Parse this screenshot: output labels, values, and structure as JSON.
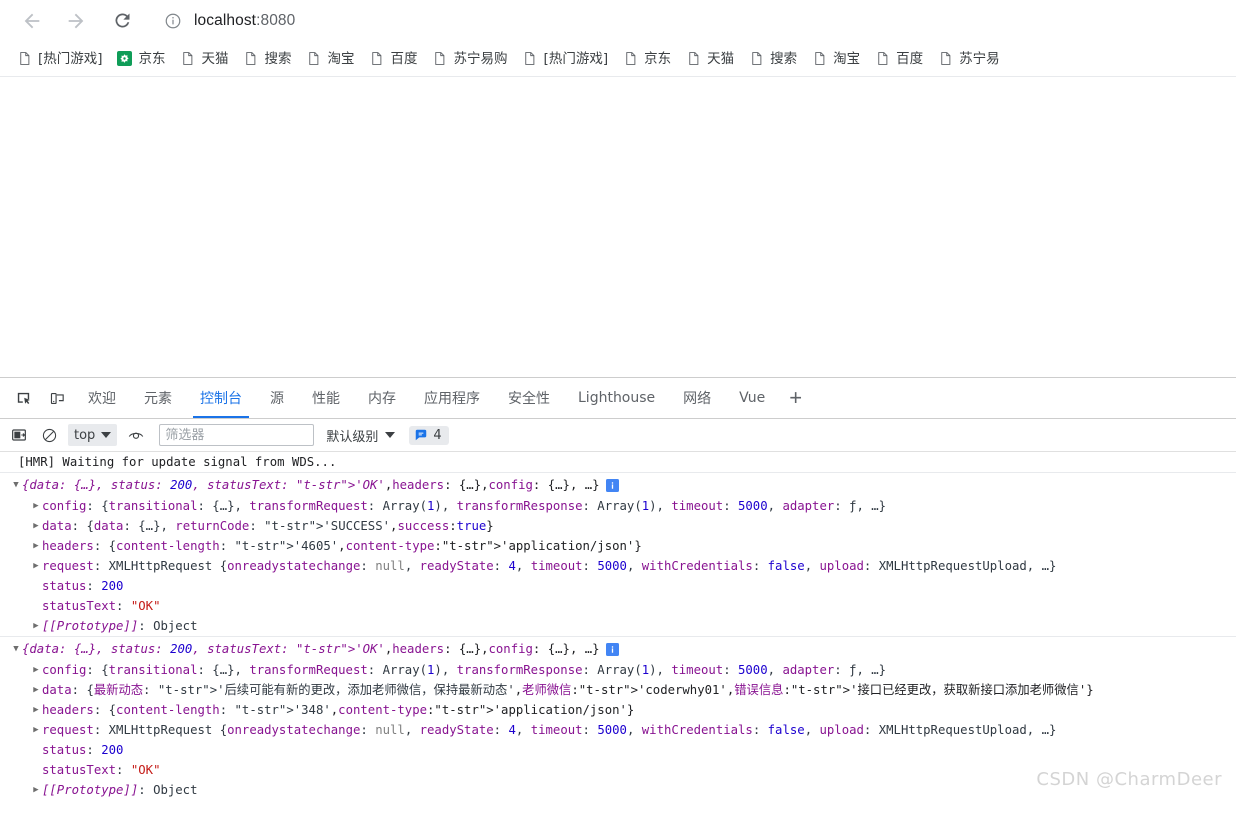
{
  "browser": {
    "nav": {
      "back_label": "Back",
      "forward_label": "Forward",
      "reload_label": "Reload"
    },
    "omnibox": {
      "url_host": "localhost",
      "url_rest": ":8080",
      "info_icon": "site-info-icon"
    },
    "bookmarks": [
      {
        "label": "[热门游戏]",
        "icon": "page-icon"
      },
      {
        "label": "京东",
        "icon": "jd-favicon-green"
      },
      {
        "label": "天猫",
        "icon": "page-icon"
      },
      {
        "label": "搜索",
        "icon": "page-icon"
      },
      {
        "label": "淘宝",
        "icon": "page-icon"
      },
      {
        "label": "百度",
        "icon": "page-icon"
      },
      {
        "label": "苏宁易购",
        "icon": "page-icon"
      },
      {
        "label": "[热门游戏]",
        "icon": "page-icon"
      },
      {
        "label": "京东",
        "icon": "page-icon"
      },
      {
        "label": "天猫",
        "icon": "page-icon"
      },
      {
        "label": "搜索",
        "icon": "page-icon"
      },
      {
        "label": "淘宝",
        "icon": "page-icon"
      },
      {
        "label": "百度",
        "icon": "page-icon"
      },
      {
        "label": "苏宁易",
        "icon": "page-icon"
      }
    ]
  },
  "devtools": {
    "tools": {
      "inspect_label": "检查元素",
      "device_label": "设备工具栏"
    },
    "tabs": [
      {
        "label": "欢迎",
        "active": false
      },
      {
        "label": "元素",
        "active": false
      },
      {
        "label": "控制台",
        "active": true
      },
      {
        "label": "源",
        "active": false
      },
      {
        "label": "性能",
        "active": false
      },
      {
        "label": "内存",
        "active": false
      },
      {
        "label": "应用程序",
        "active": false
      },
      {
        "label": "安全性",
        "active": false
      },
      {
        "label": "Lighthouse",
        "active": false
      },
      {
        "label": "网络",
        "active": false
      },
      {
        "label": "Vue",
        "active": false
      }
    ],
    "add_tab_label": "+",
    "console_toolbar": {
      "sidebar_icon": "console-sidebar-icon",
      "clear_icon": "clear-console-icon",
      "context_value": "top",
      "eye_icon": "live-expression-icon",
      "filter_placeholder": "筛选器",
      "filter_value": "",
      "level_label": "默认级别",
      "badge_icon": "info-message-icon",
      "badge_count": "4"
    },
    "accent_color": "#1a73e8"
  },
  "console": {
    "hmr_message": "[HMR] Waiting for update signal from WDS...",
    "groups": [
      {
        "summary": {
          "open_brace": "{",
          "parts": "data: {…}, status: 200, statusText: 'OK', headers: {…}, config: {…}, …",
          "close_brace": "}",
          "info_icon": "info-icon"
        },
        "rows": [
          {
            "key": "config",
            "value": "{transitional: {…}, transformRequest: Array(1), transformResponse: Array(1), timeout: 5000, adapter: ƒ, …}",
            "expandable": true
          },
          {
            "key": "data",
            "value": "{data: {…}, returnCode: 'SUCCESS', success: true}",
            "expandable": true
          },
          {
            "key": "headers",
            "value": "{content-length: '4605', content-type: 'application/json'}",
            "expandable": true
          },
          {
            "key": "request",
            "value": "XMLHttpRequest {onreadystatechange: null, readyState: 4, timeout: 5000, withCredentials: false, upload: XMLHttpRequestUpload, …}",
            "expandable": true
          },
          {
            "key": "status",
            "value": "200",
            "expandable": false
          },
          {
            "key": "statusText",
            "value": "\"OK\"",
            "expandable": false
          },
          {
            "key": "[[Prototype]]",
            "value": "Object",
            "expandable": true,
            "proto": true
          }
        ]
      },
      {
        "summary": {
          "open_brace": "{",
          "parts": "data: {…}, status: 200, statusText: 'OK', headers: {…}, config: {…}, …",
          "close_brace": "}",
          "info_icon": "info-icon"
        },
        "rows": [
          {
            "key": "config",
            "value": "{transitional: {…}, transformRequest: Array(1), transformResponse: Array(1), timeout: 5000, adapter: ƒ, …}",
            "expandable": true
          },
          {
            "key": "data",
            "value": "{最新动态: '后续可能有新的更改，添加老师微信，保持最新动态', 老师微信: 'coderwhy01', 错误信息: '接口已经更改，获取新接口添加老师微信'}",
            "expandable": true
          },
          {
            "key": "headers",
            "value": "{content-length: '348', content-type: 'application/json'}",
            "expandable": true
          },
          {
            "key": "request",
            "value": "XMLHttpRequest {onreadystatechange: null, readyState: 4, timeout: 5000, withCredentials: false, upload: XMLHttpRequestUpload, …}",
            "expandable": true
          },
          {
            "key": "status",
            "value": "200",
            "expandable": false
          },
          {
            "key": "statusText",
            "value": "\"OK\"",
            "expandable": false
          },
          {
            "key": "[[Prototype]]",
            "value": "Object",
            "expandable": true,
            "proto": true
          }
        ]
      }
    ]
  },
  "watermark": "CSDN @CharmDeer"
}
